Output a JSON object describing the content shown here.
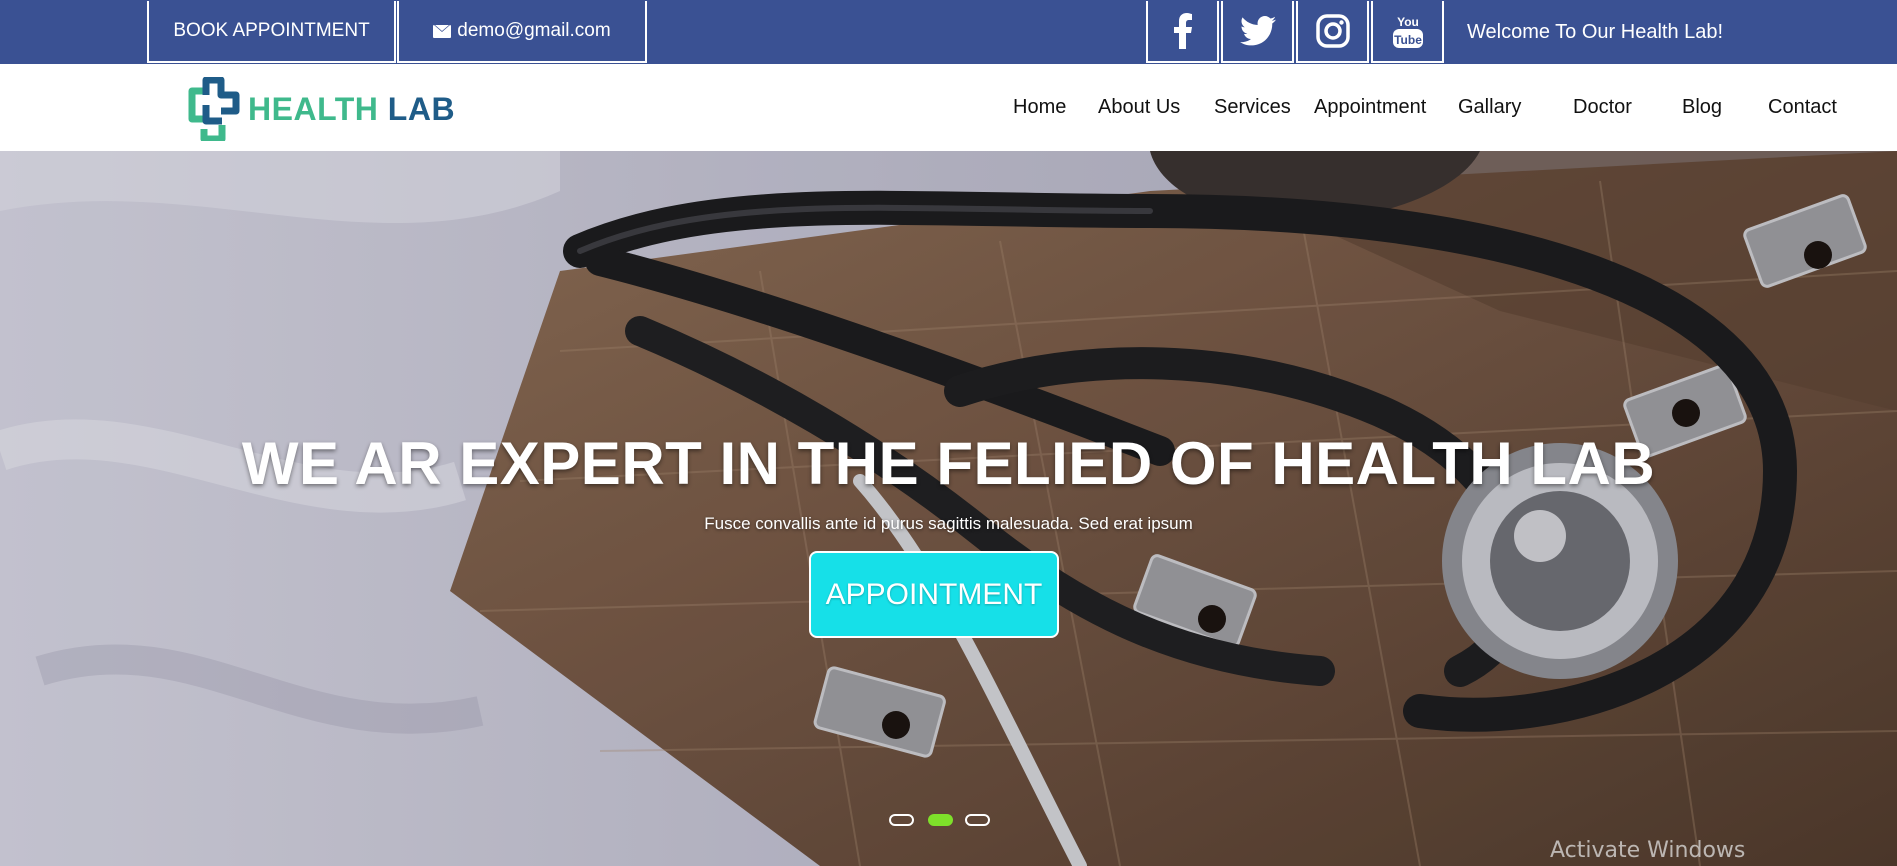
{
  "topbar": {
    "book_label": "BOOK APPOINTMENT",
    "email": "demo@gmail.com",
    "email_icon": "envelope-icon",
    "social": [
      {
        "name": "facebook",
        "icon": "facebook-icon"
      },
      {
        "name": "twitter",
        "icon": "twitter-icon"
      },
      {
        "name": "instagram",
        "icon": "instagram-icon"
      },
      {
        "name": "youtube",
        "icon": "youtube-icon"
      }
    ],
    "welcome": "Welcome To Our Health Lab!",
    "bg_color": "#3a5193"
  },
  "logo": {
    "word1": "HEALTH",
    "word2": "LAB",
    "colors": {
      "green": "#3fb98c",
      "blue": "#1f5c88"
    }
  },
  "nav": {
    "items": [
      "Home",
      "About Us",
      "Services",
      "Appointment",
      "Gallary",
      "Doctor",
      "Blog",
      "Contact"
    ]
  },
  "hero": {
    "title": "WE AR EXPERT IN THE FELIED OF HEALTH LAB",
    "subtitle": "Fusce convallis ante id purus sagittis malesuada. Sed erat ipsum",
    "button_label": "APPOINTMENT",
    "button_color": "#16e0e8",
    "carousel": {
      "slides": 3,
      "active": 2,
      "active_color": "#7ee02a"
    }
  },
  "os_overlay": {
    "watermark": "Activate Windows"
  }
}
